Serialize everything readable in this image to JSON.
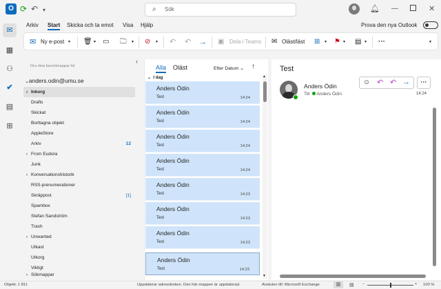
{
  "titlebar": {
    "search_placeholder": "Sök"
  },
  "menu": [
    "Arkiv",
    "Start",
    "Skicka och ta emot",
    "Visa",
    "Hjälp"
  ],
  "try_new_outlook": "Prova den nya Outlook",
  "ribbon": {
    "new_email": "Ny e-post",
    "share_teams": "Dela i Teams",
    "read_unread": "Oläst/läst"
  },
  "folders": {
    "favorites_hint": "Dra dina favoritmappar hit",
    "account": "anders.odin@umu.se",
    "items": [
      {
        "label": "Inkorg",
        "count": "",
        "arrow": true,
        "selected": true
      },
      {
        "label": "Drafts",
        "count": ""
      },
      {
        "label": "Skickat",
        "count": ""
      },
      {
        "label": "Borttagna objekt",
        "count": ""
      },
      {
        "label": "AppleStore",
        "count": ""
      },
      {
        "label": "Arkiv",
        "count": "12"
      },
      {
        "label": "From Eudora",
        "count": "",
        "arrow": true
      },
      {
        "label": "Junk",
        "count": ""
      },
      {
        "label": "Konversationshistorik",
        "count": "",
        "arrow": true
      },
      {
        "label": "RSS-prenumerationer",
        "count": ""
      },
      {
        "label": "Skräppost",
        "count": "[1]"
      },
      {
        "label": "Spambox",
        "count": ""
      },
      {
        "label": "Stefan Sandström",
        "count": ""
      },
      {
        "label": "Trash",
        "count": ""
      },
      {
        "label": "Unwanted",
        "count": "",
        "arrow": true
      },
      {
        "label": "Utkast",
        "count": ""
      },
      {
        "label": "Utkorg",
        "count": ""
      },
      {
        "label": "Viktigt",
        "count": ""
      },
      {
        "label": "Sökmappar",
        "count": "",
        "arrow": true
      }
    ]
  },
  "list": {
    "tab_all": "Alla",
    "tab_unread": "Oläst",
    "sort": "Efter Datum",
    "group": "I dag",
    "messages": [
      {
        "from": "Anders Ödin",
        "subject": "Test",
        "time": "14:24"
      },
      {
        "from": "Anders Ödin",
        "subject": "Test",
        "time": "14:24"
      },
      {
        "from": "Anders Ödin",
        "subject": "Test",
        "time": "14:24"
      },
      {
        "from": "Anders Ödin",
        "subject": "Test",
        "time": "14:24"
      },
      {
        "from": "Anders Ödin",
        "subject": "Test",
        "time": "14:23"
      },
      {
        "from": "Anders Ödin",
        "subject": "Test",
        "time": "14:23"
      },
      {
        "from": "Anders Ödin",
        "subject": "Test",
        "time": "14:23"
      },
      {
        "from": "Anders Ödin",
        "subject": "Test",
        "time": "14:23"
      }
    ]
  },
  "reader": {
    "subject": "Test",
    "sender": "Anders Ödin",
    "to_label": "Till",
    "recipient": "Anders Ödin",
    "time": "14:24"
  },
  "status": {
    "items": "Objekt: 1 811",
    "message": "Uppdaterar adressboken.  Den här mappen är uppdaterad.",
    "connection": "Ansluten till: Microsoft Exchange",
    "zoom": "100 %"
  },
  "colors": {
    "accent": "#0f6cbd",
    "selected_message": "#cfe4fa",
    "flag_red": "#c50f1f",
    "presence_green": "#13a10e"
  }
}
